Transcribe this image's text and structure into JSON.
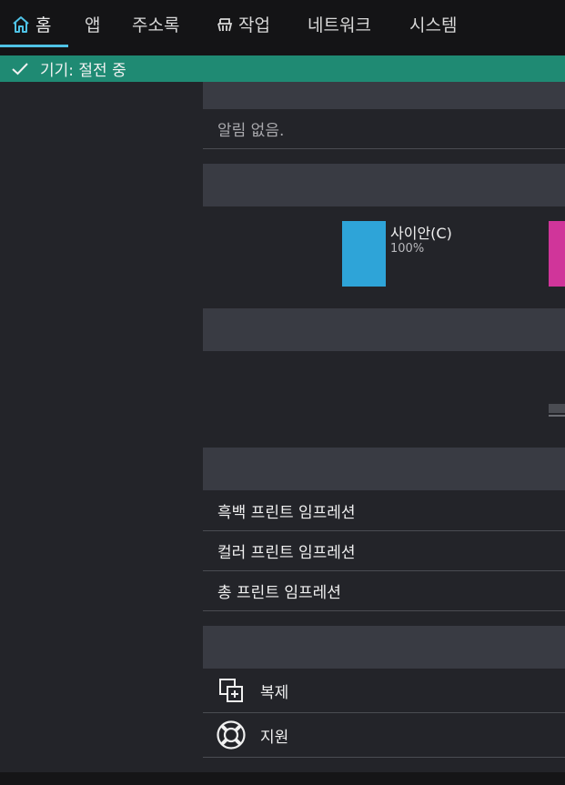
{
  "nav": {
    "tabs": [
      {
        "label": "홈",
        "icon": "home-icon",
        "active": true
      },
      {
        "label": "앱"
      },
      {
        "label": "주소록"
      },
      {
        "label": "작업",
        "icon": "job-icon"
      },
      {
        "label": "네트워크"
      },
      {
        "label": "시스템"
      }
    ],
    "accent": "#4fc3e6"
  },
  "status": {
    "icon": "check-icon",
    "text": "기기: 절전 중",
    "color": "#1f8a73"
  },
  "alerts": {
    "empty_text": "알림 없음."
  },
  "toner": {
    "items": [
      {
        "name": "사이안(C)",
        "level": "100%",
        "color": "#2ea4d8"
      },
      {
        "color": "#d0359a"
      }
    ]
  },
  "counters": {
    "rows": [
      {
        "label": "흑백 프린트 임프레션"
      },
      {
        "label": "컬러 프린트 임프레션"
      },
      {
        "label": "총 프린트 임프레션"
      }
    ]
  },
  "links": {
    "rows": [
      {
        "label": "복제",
        "icon": "copy-add-icon"
      },
      {
        "label": "지원",
        "icon": "lifebuoy-icon"
      }
    ]
  }
}
